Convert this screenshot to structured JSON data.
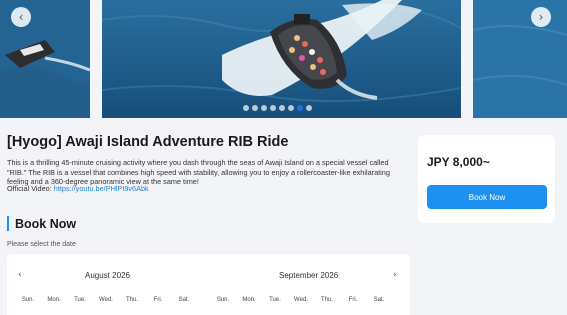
{
  "carousel": {
    "prev_icon": "‹",
    "next_icon": "›",
    "slide_count": 8,
    "active_index": 6
  },
  "activity": {
    "title": "[Hyogo] Awaji Island Adventure RIB Ride",
    "description": "This is a thrilling 45-minute cruising activity where you dash through the seas of Awaji Island on a special vessel called \"RIB.\" The RIB is a vessel that combines high speed with stability, allowing you to enjoy a rollercoaster-like exhilarating feeling and a 360-degree panoramic view at the same time!",
    "video_label": "Official Video: ",
    "video_link": "https://youtu.be/PHlPI9v6Abk"
  },
  "booking_card": {
    "price": "JPY 8,000~",
    "button_label": "Book Now"
  },
  "book_section": {
    "title": "Book Now",
    "subtitle": "Please select the date"
  },
  "calendar": {
    "prev_icon": "‹",
    "next_icon": "›",
    "months": [
      {
        "label": "August 2026",
        "weekdays": [
          "Sun.",
          "Mon.",
          "Tue.",
          "Wed.",
          "Thu.",
          "Fri.",
          "Sat."
        ]
      },
      {
        "label": "September 2026",
        "weekdays": [
          "Sun.",
          "Mon.",
          "Tue.",
          "Wed.",
          "Thu.",
          "Fri.",
          "Sat."
        ]
      }
    ]
  },
  "colors": {
    "accent": "#1e90f0",
    "link": "#1f7fd6",
    "page_bg": "#f2f4f7",
    "sea": "#1f5d8c"
  }
}
